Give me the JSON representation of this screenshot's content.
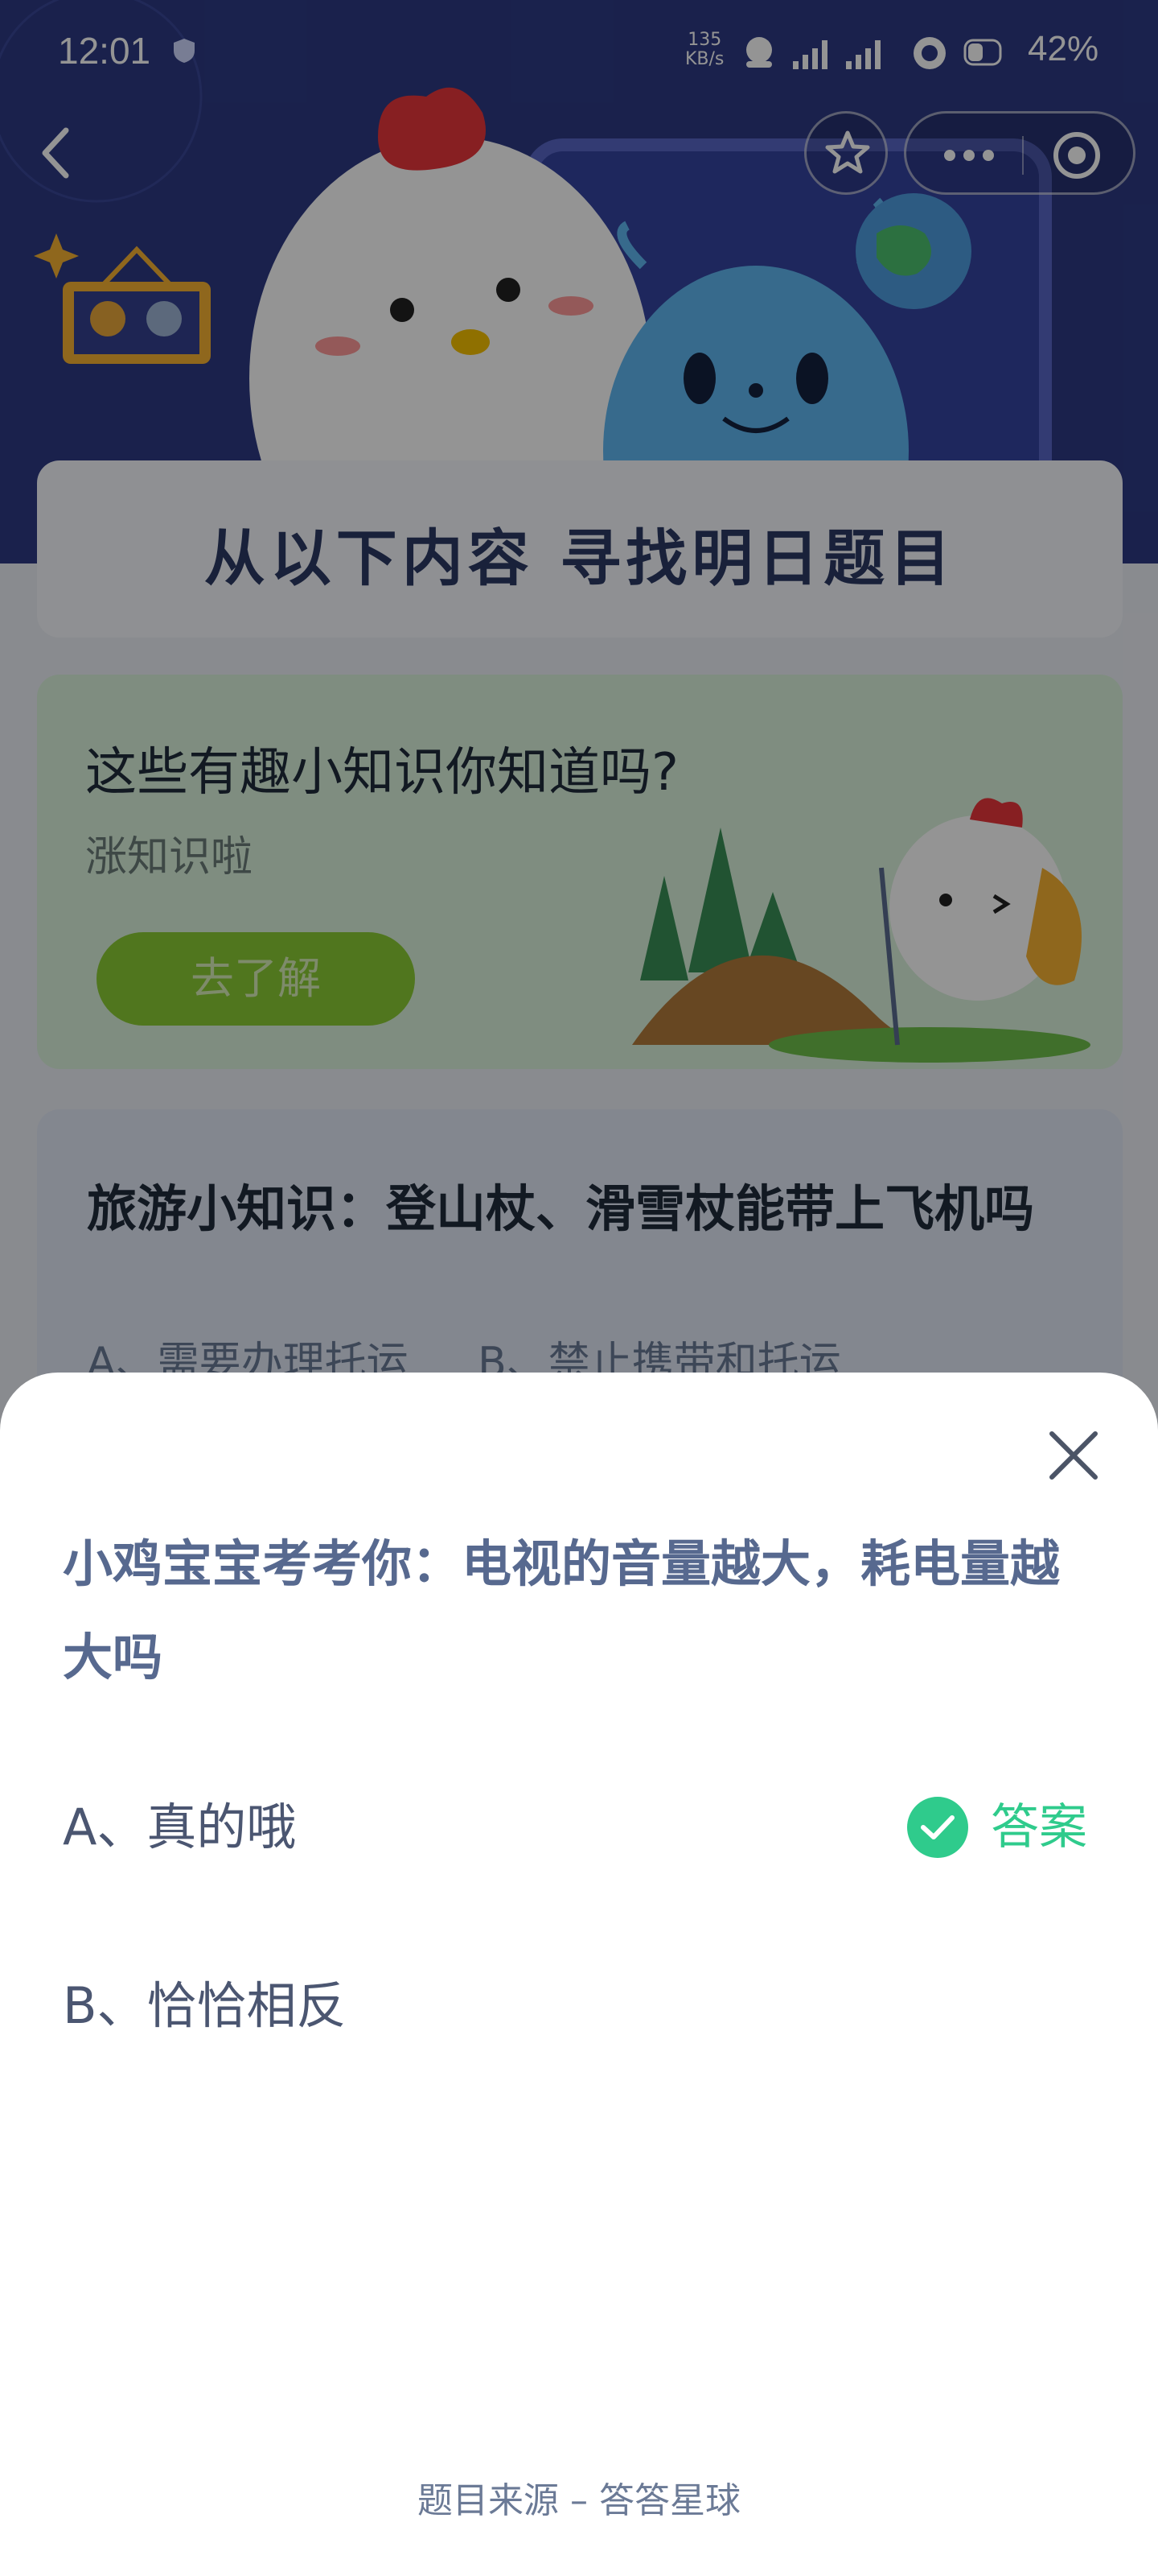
{
  "status_bar": {
    "time": "12:01",
    "net_speed_value": "135",
    "net_speed_unit": "KB/s",
    "battery": "42%"
  },
  "nav": {
    "back_icon": "chevron-left-icon",
    "favorite_icon": "star-icon",
    "more_icon": "more-dots-icon",
    "close_app_icon": "target-icon"
  },
  "page": {
    "title": "从以下内容 寻找明日题目",
    "knowledge_card": {
      "title": "这些有趣小知识你知道吗?",
      "subtitle": "涨知识啦",
      "button_label": "去了解"
    },
    "travel_card": {
      "title": "旅游小知识：登山杖、滑雪杖能带上飞机吗",
      "option_a": "A、需要办理托运",
      "option_b": "B、禁止携带和托运"
    }
  },
  "quiz_sheet": {
    "question": "小鸡宝宝考考你：电视的音量越大，耗电量越大吗",
    "options": [
      {
        "label": "A、真的哦",
        "is_answer": true
      },
      {
        "label": "B、恰恰相反",
        "is_answer": false
      }
    ],
    "answer_label": "答案",
    "source": "题目来源 – 答答星球"
  },
  "colors": {
    "accent_green": "#2fcb8c",
    "question_blue": "#57698f",
    "button_green": "#8acb35"
  }
}
